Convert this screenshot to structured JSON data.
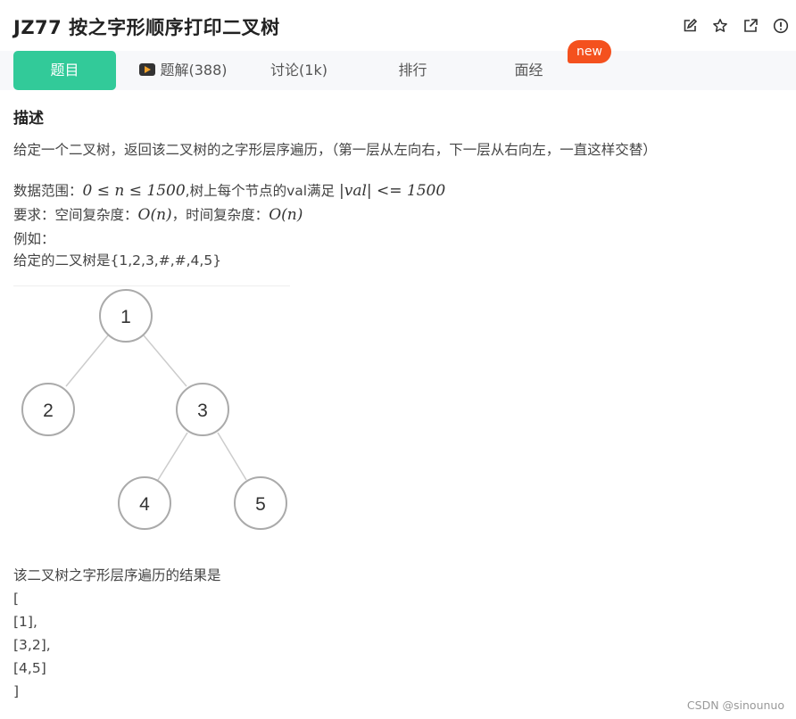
{
  "header": {
    "title": "JZ77  按之字形顺序打印二叉树",
    "actions": [
      {
        "icon": "edit-icon"
      },
      {
        "icon": "star-icon"
      },
      {
        "icon": "share-icon"
      },
      {
        "icon": "report-icon"
      }
    ]
  },
  "tabs": [
    {
      "label": "题目",
      "active": true
    },
    {
      "label": "题解(388)",
      "icon": "video-icon"
    },
    {
      "label": "讨论(1k)"
    },
    {
      "label": "排行"
    },
    {
      "label": "面经",
      "badge": "new"
    }
  ],
  "description": {
    "heading": "描述",
    "intro": "给定一个二叉树，返回该二叉树的之字形层序遍历，（第一层从左向右，下一层从右向左，一直这样交替）",
    "range_prefix": "数据范围：",
    "range_math_1": "0 ≤ n ≤ 1500",
    "range_middle": ",树上每个节点的val满足 ",
    "range_math_2": "|val| <= 1500",
    "req_prefix": "要求：空间复杂度：",
    "req_space": "O(n)",
    "req_middle": "，时间复杂度：",
    "req_time": "O(n)",
    "example_label": "例如：",
    "tree_label": "给定的二叉树是{1,2,3,#,#,4,5}"
  },
  "tree": {
    "nodes": [
      {
        "label": "1"
      },
      {
        "label": "2"
      },
      {
        "label": "3"
      },
      {
        "label": "4"
      },
      {
        "label": "5"
      }
    ]
  },
  "result": {
    "caption": "该二叉树之字形层序遍历的结果是",
    "lines": [
      "[",
      "[1],",
      "[3,2],",
      "[4,5]",
      "]"
    ]
  },
  "watermark": "CSDN @sinounuo"
}
